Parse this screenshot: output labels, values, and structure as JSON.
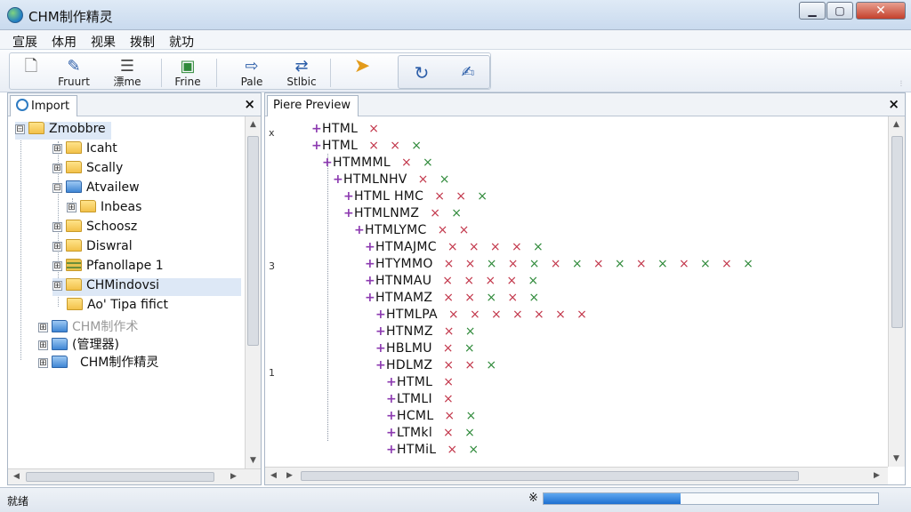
{
  "window": {
    "title": "CHM制作精灵",
    "minimize": "▁",
    "maximize": "▢",
    "close": "✕"
  },
  "menu": [
    "宣展",
    "体用",
    "视果",
    "拨制",
    "就功"
  ],
  "toolbar": {
    "buttons": [
      {
        "name": "new",
        "label": "",
        "icon": "page-icon"
      },
      {
        "name": "import",
        "label": "Fruurt",
        "icon": "pen-icon"
      },
      {
        "name": "name",
        "label": "漂me",
        "icon": "document-icon"
      },
      {
        "name": "frame",
        "label": "Frine",
        "icon": "image-icon"
      },
      {
        "name": "page",
        "label": "Pale",
        "icon": "export-icon"
      },
      {
        "name": "switch",
        "label": "Stlbic",
        "icon": "swap-icon"
      },
      {
        "name": "compile",
        "label": "",
        "icon": "arrow-icon"
      },
      {
        "name": "refresh",
        "label": "",
        "icon": "refresh-icon"
      },
      {
        "name": "edit",
        "label": "",
        "icon": "edit-icon"
      }
    ]
  },
  "left_panel": {
    "tab": "Import",
    "close": "×",
    "tree": [
      {
        "label": "Zmobbre",
        "level": 0,
        "expander": "⊟",
        "selected": true,
        "icon": "folder"
      },
      {
        "label": "Icaht",
        "level": 1,
        "expander": "⊞",
        "icon": "folder"
      },
      {
        "label": "Scally",
        "level": 1,
        "expander": "⊞",
        "icon": "folder"
      },
      {
        "label": "Atvailew",
        "level": 1,
        "expander": "⊟",
        "icon": "blue"
      },
      {
        "label": "Inbeas",
        "level": 2,
        "expander": "⊞",
        "icon": "folder"
      },
      {
        "label": "Schoosz",
        "level": 1,
        "expander": "⊞",
        "icon": "folder"
      },
      {
        "label": "Diswral",
        "level": 1,
        "expander": "⊞",
        "icon": "folder"
      },
      {
        "label": "Pfanollape 1",
        "level": 1,
        "expander": "⊞",
        "icon": "stack"
      },
      {
        "label": "CHMindovsi",
        "level": 1,
        "expander": "⊞",
        "icon": "folder",
        "highlight": true
      },
      {
        "label": "Ao' Tipa  fifict",
        "level": 1,
        "expander": "",
        "icon": "folder"
      },
      {
        "label": "CHM制作术",
        "level": 0,
        "expander": "⊞",
        "icon": "blue",
        "dim": true
      },
      {
        "label": "(管理器)",
        "level": 0,
        "expander": "⊞",
        "icon": "blue"
      },
      {
        "label": "CHM制作精灵",
        "level": 0,
        "expander": "⊞",
        "icon": "blue"
      }
    ]
  },
  "right_panel": {
    "tab": "Piere Preview",
    "close": "×",
    "gutter": [
      "x",
      "3",
      "1"
    ],
    "lines": [
      {
        "indent": 0,
        "text": "HTML",
        "marks": [
          "r"
        ]
      },
      {
        "indent": 0,
        "text": "HTML",
        "marks": [
          "r",
          "r",
          "g"
        ]
      },
      {
        "indent": 1,
        "text": "HTMMML",
        "marks": [
          "r",
          "g"
        ]
      },
      {
        "indent": 2,
        "text": "HTMLNHV",
        "marks": [
          "r",
          "g"
        ]
      },
      {
        "indent": 3,
        "text": "HTML HMC",
        "marks": [
          "r",
          "r",
          "g"
        ]
      },
      {
        "indent": 3,
        "text": "HTMLNMZ",
        "marks": [
          "r",
          "g"
        ]
      },
      {
        "indent": 4,
        "text": "HTMLYMC",
        "marks": [
          "r",
          "r"
        ]
      },
      {
        "indent": 5,
        "text": "HTMAJMC",
        "marks": [
          "r",
          "r",
          "r",
          "r",
          "g"
        ]
      },
      {
        "indent": 5,
        "text": "HTYMMO",
        "marks": [
          "r",
          "r",
          "g",
          "r",
          "g",
          "r",
          "g",
          "r",
          "g",
          "r",
          "g",
          "r",
          "g",
          "r",
          "g"
        ]
      },
      {
        "indent": 5,
        "text": "HTNMAU",
        "marks": [
          "r",
          "r",
          "r",
          "r",
          "g"
        ]
      },
      {
        "indent": 5,
        "text": "HTMAMZ",
        "marks": [
          "r",
          "r",
          "g",
          "r",
          "g"
        ]
      },
      {
        "indent": 6,
        "text": "HTMLPA",
        "marks": [
          "r",
          "r",
          "r",
          "r",
          "r",
          "r",
          "r"
        ]
      },
      {
        "indent": 6,
        "text": "HTNMZ",
        "marks": [
          "r",
          "g"
        ]
      },
      {
        "indent": 6,
        "text": "HBLMU",
        "marks": [
          "r",
          "g"
        ]
      },
      {
        "indent": 6,
        "text": "HDLMZ",
        "marks": [
          "r",
          "r",
          "g"
        ]
      },
      {
        "indent": 7,
        "text": "HTML",
        "marks": [
          "r"
        ]
      },
      {
        "indent": 7,
        "text": "LTMLI",
        "marks": [
          "r"
        ]
      },
      {
        "indent": 7,
        "text": "HCML",
        "marks": [
          "r",
          "g"
        ]
      },
      {
        "indent": 7,
        "text": "LTMkl",
        "marks": [
          "r",
          "g"
        ]
      },
      {
        "indent": 7,
        "text": "HTMiL",
        "marks": [
          "r",
          "g"
        ]
      }
    ]
  },
  "status": {
    "text": "就绪",
    "icon_glyph": "※",
    "progress": 0.41
  },
  "colors": {
    "accent": "#1d6fd0",
    "mark_red": "#c2364a",
    "mark_green": "#2f8a3a",
    "plus": "#8c3ab0"
  }
}
